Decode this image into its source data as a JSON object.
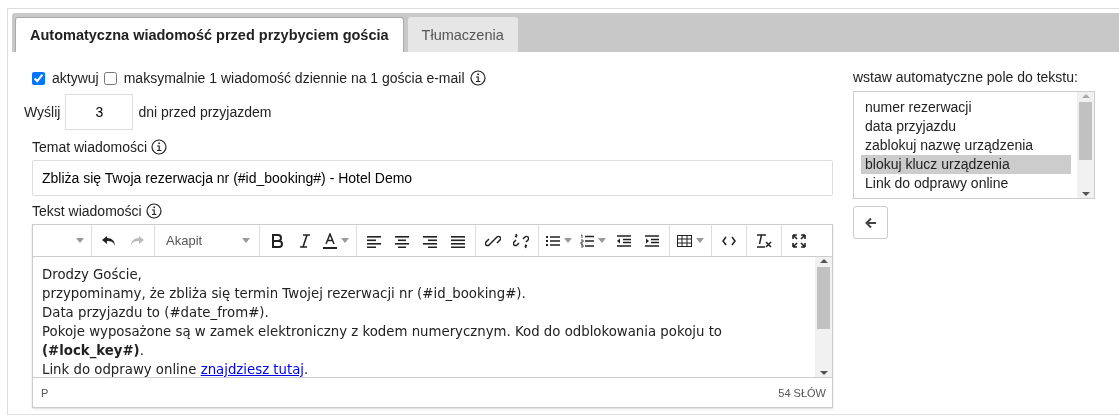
{
  "tabs": [
    {
      "label": "Automatyczna wiadomość przed przybyciem gościa",
      "selected": true
    },
    {
      "label": "Tłumaczenia",
      "selected": false
    }
  ],
  "options": [
    {
      "label": "aktywuj",
      "checked": true,
      "info": false
    },
    {
      "label": "maksymalnie 1 wiadomość dziennie na 1 gościa e-mail",
      "checked": false,
      "info": true
    }
  ],
  "send": {
    "prefix": "Wyślij",
    "value": "3",
    "suffix": "dni przed przyjazdem"
  },
  "subject": {
    "label": "Temat wiadomości",
    "value": "Zbliża się Twoja rezerwacja nr (#id_booking#) - Hotel Demo"
  },
  "body": {
    "label": "Tekst wiadomości",
    "toolbar": {
      "style_select": "Akapit",
      "redo_disabled": true
    },
    "paragraphs": [
      [
        {
          "kind": "text",
          "text": "Drodzy Goście,"
        }
      ],
      [
        {
          "kind": "text",
          "text": "przypominamy, że zbliża się termin Twojej rezerwacji nr (#id_booking#)."
        }
      ],
      [
        {
          "kind": "text",
          "text": "Data przyjazdu to (#date_from#)."
        }
      ],
      [
        {
          "kind": "text",
          "text": "Pokoje wyposażone są w zamek elektroniczny z kodem numerycznym. Kod do odblokowania pokoju to "
        },
        {
          "kind": "bold",
          "text": "(#lock_key#)"
        },
        {
          "kind": "text",
          "text": "."
        }
      ],
      [
        {
          "kind": "text",
          "text": "Link do odprawy online "
        },
        {
          "kind": "link",
          "text": "znajdziesz tutaj"
        },
        {
          "kind": "text",
          "text": "."
        }
      ]
    ],
    "status_path": "P",
    "word_count": "54 SŁÓW"
  },
  "fields": {
    "label": "wstaw automatyczne pole do tekstu:",
    "items": [
      {
        "label": "numer rezerwacji",
        "selected": false
      },
      {
        "label": "data przyjazdu",
        "selected": false
      },
      {
        "label": "zablokuj nazwę urządzenia",
        "selected": false
      },
      {
        "label": "blokuj klucz urządzenia",
        "selected": true
      },
      {
        "label": "Link do odprawy online",
        "selected": false
      }
    ]
  }
}
